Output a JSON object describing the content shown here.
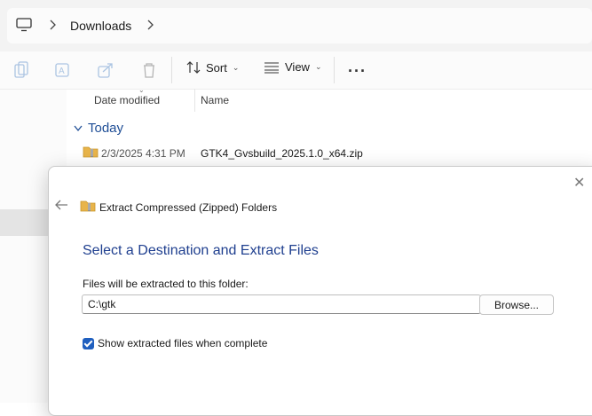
{
  "addressbar": {
    "pc_icon": "computer-icon",
    "crumbs": [
      "Downloads"
    ]
  },
  "toolbar": {
    "sort_label": "Sort",
    "view_label": "View",
    "more_label": "···",
    "icons": [
      "copy-icon",
      "rename-icon",
      "share-icon",
      "delete-icon"
    ]
  },
  "columns": {
    "date_modified": "Date modified",
    "name": "Name"
  },
  "group": {
    "label": "Today"
  },
  "files": [
    {
      "date": "2/3/2025 4:31 PM",
      "name": "GTK4_Gvsbuild_2025.1.0_x64.zip"
    }
  ],
  "dialog": {
    "title": "Extract Compressed (Zipped) Folders",
    "heading": "Select a Destination and Extract Files",
    "label": "Files will be extracted to this folder:",
    "path_value": "C:\\gtk",
    "browse_label": "Browse...",
    "checkbox_label": "Show extracted files when complete",
    "checkbox_checked": true,
    "close_label": "✕"
  },
  "colors": {
    "accent": "#1f5fbf",
    "heading": "#1f3f8f"
  }
}
